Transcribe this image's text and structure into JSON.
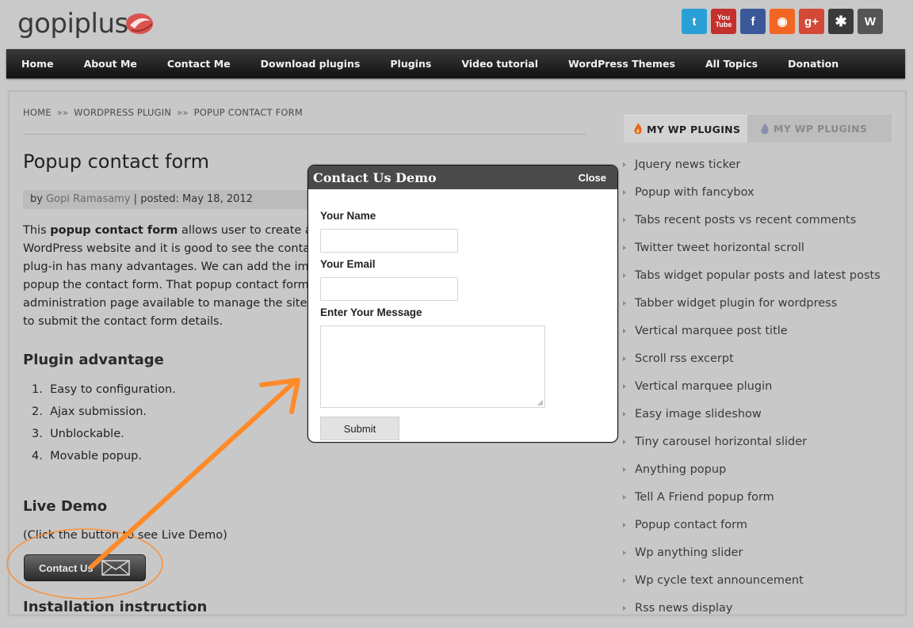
{
  "site": {
    "logo_text": "gopiplus"
  },
  "social_icons": [
    {
      "name": "twitter-icon",
      "glyph": "t",
      "color": "#2a9fd6"
    },
    {
      "name": "youtube-icon",
      "glyph": "You\nTube",
      "color": "#c4302b"
    },
    {
      "name": "facebook-icon",
      "glyph": "f",
      "color": "#3b5998"
    },
    {
      "name": "rss-icon",
      "glyph": "◉",
      "color": "#f26522"
    },
    {
      "name": "google-plus-icon",
      "glyph": "g+",
      "color": "#d34836"
    },
    {
      "name": "joomla-icon",
      "glyph": "✱",
      "color": "#3a3a3a"
    },
    {
      "name": "wordpress-icon",
      "glyph": "W",
      "color": "#555555"
    }
  ],
  "nav": [
    "Home",
    "About Me",
    "Contact Me",
    "Download plugins",
    "Plugins",
    "Video tutorial",
    "WordPress Themes",
    "All Topics",
    "Donation"
  ],
  "breadcrumb": [
    "HOME",
    "WORDPRESS PLUGIN",
    "POPUP CONTACT FORM"
  ],
  "breadcrumb_sep": "»»",
  "post": {
    "title": "Popup contact form",
    "meta_by": "by ",
    "author": "Gopi Ramasamy",
    "meta_posted": " | posted: May 18, 2012",
    "intro_lines": [
      "This ",
      "popup contact form",
      " allows user to create an",
      "WordPress website and it is good to see the conta",
      "plug-in has many advantages. We can add the ima",
      "popup the contact form. That popup contact form",
      "administration page available to manage the site ac",
      "to submit the contact form details."
    ],
    "advantage_heading": "Plugin advantage",
    "advantages": [
      "Easy to configuration.",
      "Ajax submission.",
      "Unblockable.",
      "Movable popup."
    ],
    "demo_heading": "Live Demo",
    "demo_hint": "(Click the button to see Live Demo)",
    "contact_button": "Contact Us",
    "install_heading": "Installation instruction"
  },
  "sidebar": {
    "tabs": [
      "MY WP PLUGINS",
      "MY WP PLUGINS"
    ],
    "items": [
      "Jquery news ticker",
      "Popup with fancybox",
      "Tabs recent posts vs recent comments",
      "Twitter tweet horizontal scroll",
      "Tabs widget popular posts and latest posts",
      "Tabber widget plugin for wordpress",
      "Vertical marquee post title",
      "Scroll rss excerpt",
      "Vertical marquee plugin",
      "Easy image slideshow",
      "Tiny carousel horizontal slider",
      "Anything popup",
      "Tell A Friend popup form",
      "Popup contact form",
      "Wp anything slider",
      "Wp cycle text announcement",
      "Rss news display"
    ]
  },
  "modal": {
    "title": "Contact Us Demo",
    "close": "Close",
    "name_label": "Your Name",
    "email_label": "Your Email",
    "message_label": "Enter Your Message",
    "submit": "Submit"
  },
  "colors": {
    "annotation": "#ff8a2a",
    "nav_bg": "#1e1e1e"
  }
}
